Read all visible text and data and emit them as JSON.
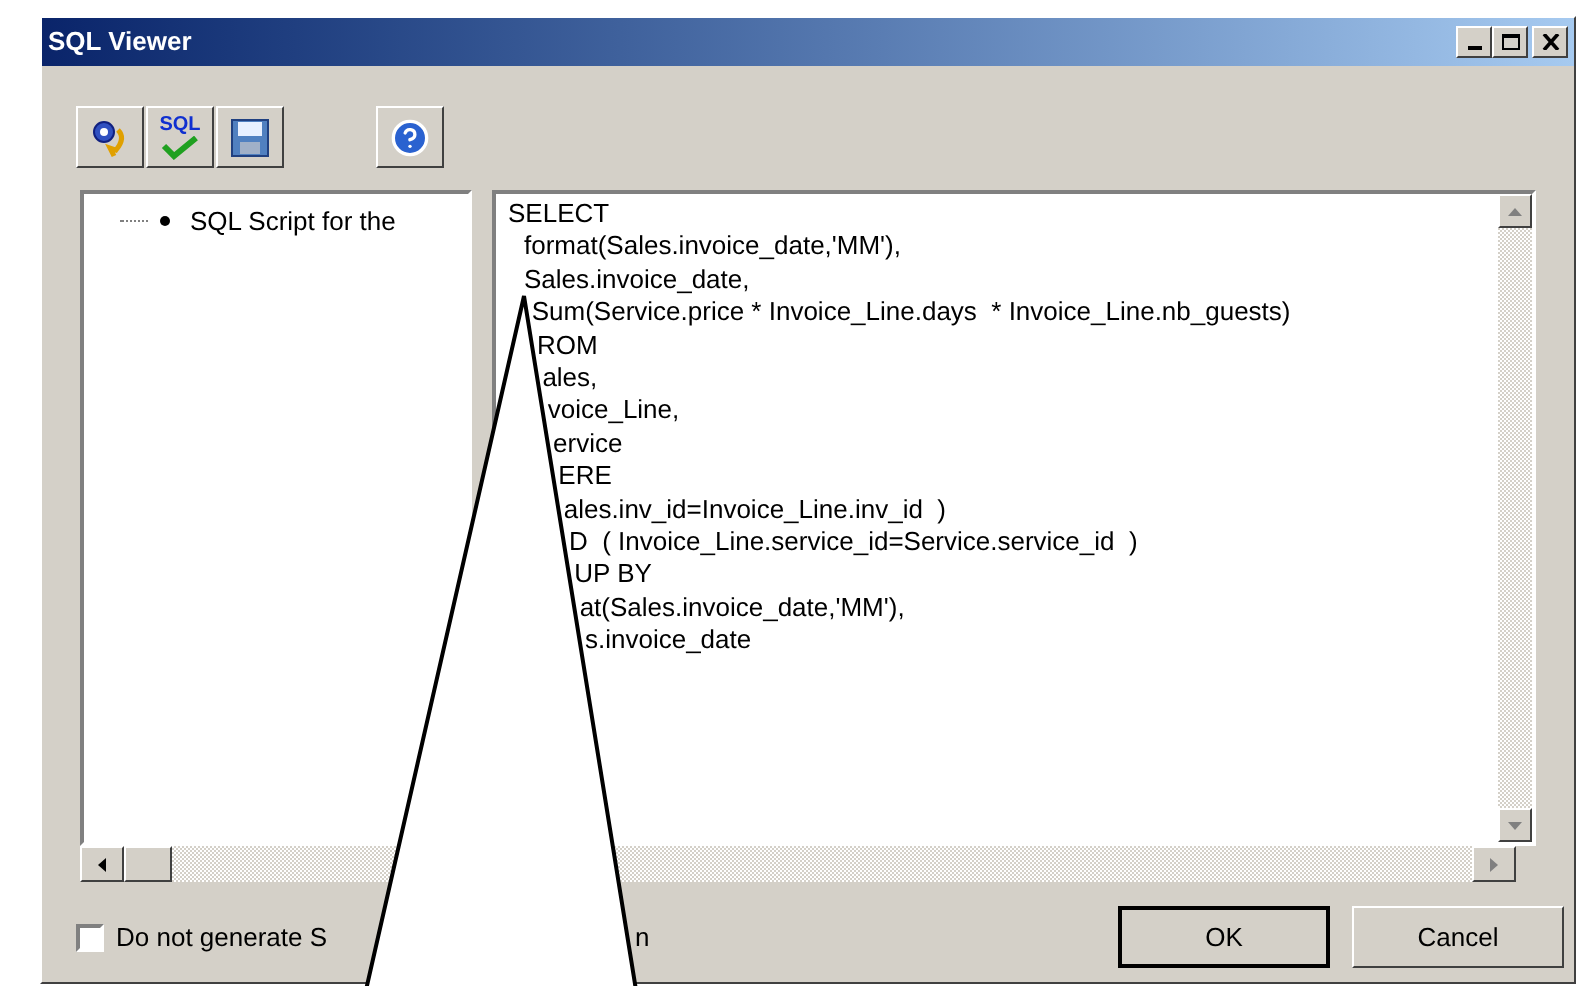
{
  "window": {
    "title": "SQL Viewer"
  },
  "toolbar": [
    {
      "kind": "run"
    },
    {
      "kind": "check",
      "label": "SQL"
    },
    {
      "kind": "save"
    },
    {
      "kind": "help"
    }
  ],
  "tree": {
    "items": [
      {
        "label": "SQL Script for the"
      }
    ]
  },
  "sql_lines": [
    "SELECT",
    " format(Sales.invoice_date,'MM'),",
    " Sales.invoice_date,",
    " Sum(Service.price * Invoice_Line.days  * Invoice_Line.nb_guests)",
    "ROM",
    "ales,",
    "voice_Line,",
    "ervice",
    "ERE",
    "ales.inv_id=Invoice_Line.inv_id  )",
    "D  ( Invoice_Line.service_id=Service.service_id  )",
    "UP BY",
    "at(Sales.invoice_date,'MM'),",
    "s.invoice_date"
  ],
  "option": {
    "label": "Do not generate S",
    "label_tail": "n",
    "checked": false
  },
  "buttons": [
    {
      "label": "OK",
      "default": true
    },
    {
      "label": "Cancel",
      "default": false
    }
  ]
}
